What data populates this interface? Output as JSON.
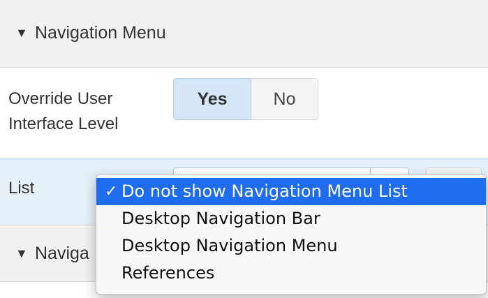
{
  "sections": {
    "top": {
      "title": "Navigation Menu",
      "caret": "▼"
    },
    "bottom": {
      "title": "Naviga",
      "caret": "▼"
    }
  },
  "override": {
    "label_line1": "Override User",
    "label_line2": "Interface Level",
    "yes_label": "Yes",
    "no_label": "No",
    "selected": "Yes"
  },
  "list": {
    "label": "List",
    "selected_value": "Do not show Navigation Menu List",
    "options": [
      {
        "label": "Do not show Navigation Menu List",
        "selected": true,
        "check": "✓"
      },
      {
        "label": "Desktop Navigation Bar",
        "selected": false
      },
      {
        "label": "Desktop Navigation Menu",
        "selected": false
      },
      {
        "label": "References",
        "selected": false
      }
    ]
  },
  "colors": {
    "highlight": "#1e6cf0",
    "toggle_active": "#d5e7f7",
    "list_row_bg": "#e6f0f9",
    "section_bg": "#f1f1f1"
  }
}
